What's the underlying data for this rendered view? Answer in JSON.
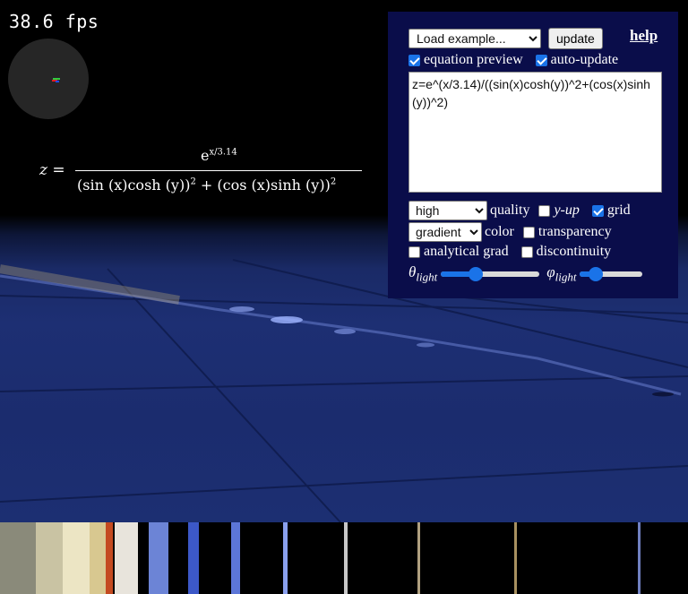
{
  "stats": {
    "fps": "38.6 fps"
  },
  "equation_preview": {
    "lhs": "z =",
    "numerator_base": "e",
    "numerator_exp": "x/3.14",
    "denominator": "(sin (x)cosh (y))",
    "denominator_mid": " + (cos (x)sinh (y))",
    "power": "2"
  },
  "panel": {
    "example_select": {
      "selected": "Load example..."
    },
    "update_label": "update",
    "help_label": "help",
    "equation_preview": {
      "label": "equation preview",
      "checked": true
    },
    "auto_update": {
      "label": "auto-update",
      "checked": true
    },
    "equation_text": "z=e^(x/3.14)/((sin(x)cosh(y))^2+(cos(x)sinh(y))^2)",
    "quality": {
      "selected": "high",
      "label": "quality"
    },
    "y_up": {
      "label": "y-up",
      "checked": false
    },
    "grid": {
      "label": "grid",
      "checked": true
    },
    "color": {
      "selected": "gradient",
      "label": "color"
    },
    "transparency": {
      "label": "transparency",
      "checked": false
    },
    "analytical_grad": {
      "label": "analytical grad",
      "checked": false
    },
    "discontinuity": {
      "label": "discontinuity",
      "checked": false
    },
    "theta_light": {
      "symbol": "θ",
      "sub": "light",
      "value_fraction": 0.35
    },
    "phi_light": {
      "symbol": "φ",
      "sub": "light",
      "value_fraction": 0.25
    }
  },
  "colors": {
    "panel_bg": "#0a0d4a",
    "surface": "#1d2f73",
    "checkbox_accent": "#1a73e8"
  }
}
